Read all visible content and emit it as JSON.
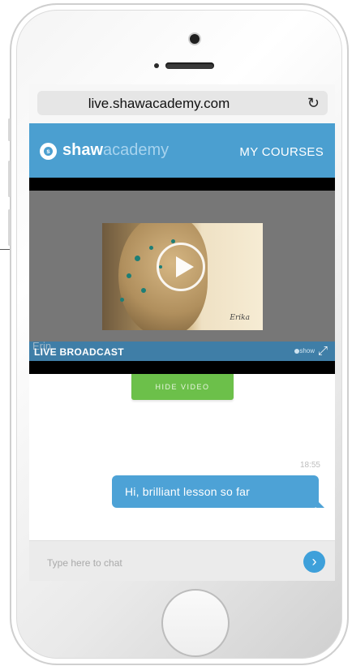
{
  "browser": {
    "url": "live.shawacademy.com",
    "reload_icon": "reload-icon"
  },
  "app": {
    "brand_bold": "shaw",
    "brand_light": "academy",
    "logo_letter": "s",
    "nav_my_courses": "MY COURSES"
  },
  "video": {
    "live_label": "LIVE BROADCAST",
    "live_ghost": "Erin",
    "show_label": "show",
    "signature": "Erika",
    "hide_button": "HIDE VIDEO"
  },
  "chat": {
    "messages": [
      {
        "time": "18:55",
        "text": "Hi, brilliant lesson so far"
      }
    ],
    "input_placeholder": "Type here to chat",
    "send_icon": "send-icon"
  },
  "colors": {
    "accent": "#4b9fd0",
    "hide_button": "#6cc04a",
    "bubble": "#4da2d6"
  }
}
